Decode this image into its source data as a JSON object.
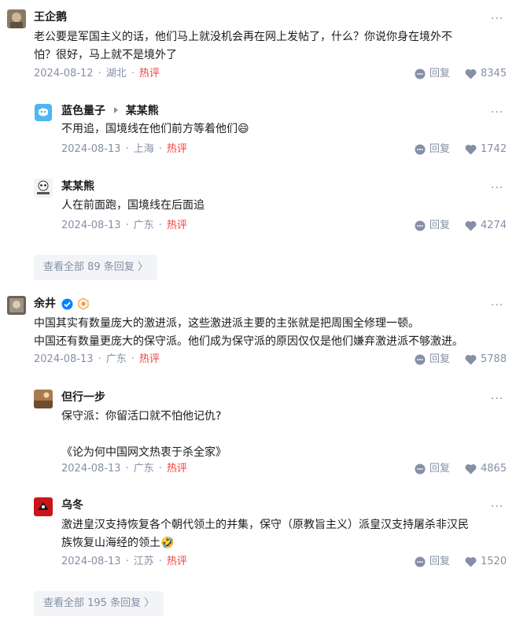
{
  "icons": {
    "more": "more-dots-icon",
    "reply": "reply-bubble-icon",
    "like": "heart-icon",
    "chevron": "chevron-right-icon",
    "verified": "verified-check-icon",
    "hex": "hexagon-badge-icon",
    "reply_arrow": "triangle-right-icon"
  },
  "colors": {
    "hot": "#f1403c",
    "meta": "#8590a6",
    "verified": "#0084ff"
  },
  "comments": [
    {
      "author": "王企鹅",
      "lines": [
        "老公要是军国主义的话，他们马上就没机会再在网上发帖了，什么？你说你身在境外不",
        "怕？很好，马上就不是境外了"
      ],
      "date": "2024-08-12",
      "location": "湖北",
      "tag": "热评",
      "reply": "回复",
      "likes": "8345",
      "replies": [
        {
          "author": "蓝色量子",
          "reply_to": "某某熊",
          "lines": [
            "不用追，国境线在他们前方等着他们😄"
          ],
          "date": "2024-08-13",
          "location": "上海",
          "tag": "热评",
          "reply": "回复",
          "likes": "1742"
        },
        {
          "author": "某某熊",
          "lines": [
            "人在前面跑，国境线在后面追"
          ],
          "date": "2024-08-13",
          "location": "广东",
          "tag": "热评",
          "reply": "回复",
          "likes": "4274"
        }
      ],
      "view_all": "查看全部 89 条回复 〉"
    },
    {
      "author": "余井",
      "lines": [
        "中国其实有数量庞大的激进派，这些激进派主要的主张就是把周围全修理一顿。",
        "中国还有数量更庞大的保守派。他们成为保守派的原因仅仅是他们嫌弃激进派不够激进。"
      ],
      "date": "2024-08-13",
      "location": "广东",
      "tag": "热评",
      "reply": "回复",
      "likes": "5788",
      "replies": [
        {
          "author": "但行一步",
          "lines": [
            "保守派：你留活口就不怕他记仇?",
            "",
            "《论为何中国网文热衷于杀全家》"
          ],
          "date": "2024-08-13",
          "location": "广东",
          "tag": "热评",
          "reply": "回复",
          "likes": "4865"
        },
        {
          "author": "乌冬",
          "lines": [
            "激进皇汉支持恢复各个朝代领土的并集，保守（原教旨主义）派皇汉支持屠杀非汉民",
            "族恢复山海经的领土🤣"
          ],
          "date": "2024-08-13",
          "location": "江苏",
          "tag": "热评",
          "reply": "回复",
          "likes": "1520"
        }
      ],
      "view_all": "查看全部 195 条回复 〉"
    }
  ]
}
